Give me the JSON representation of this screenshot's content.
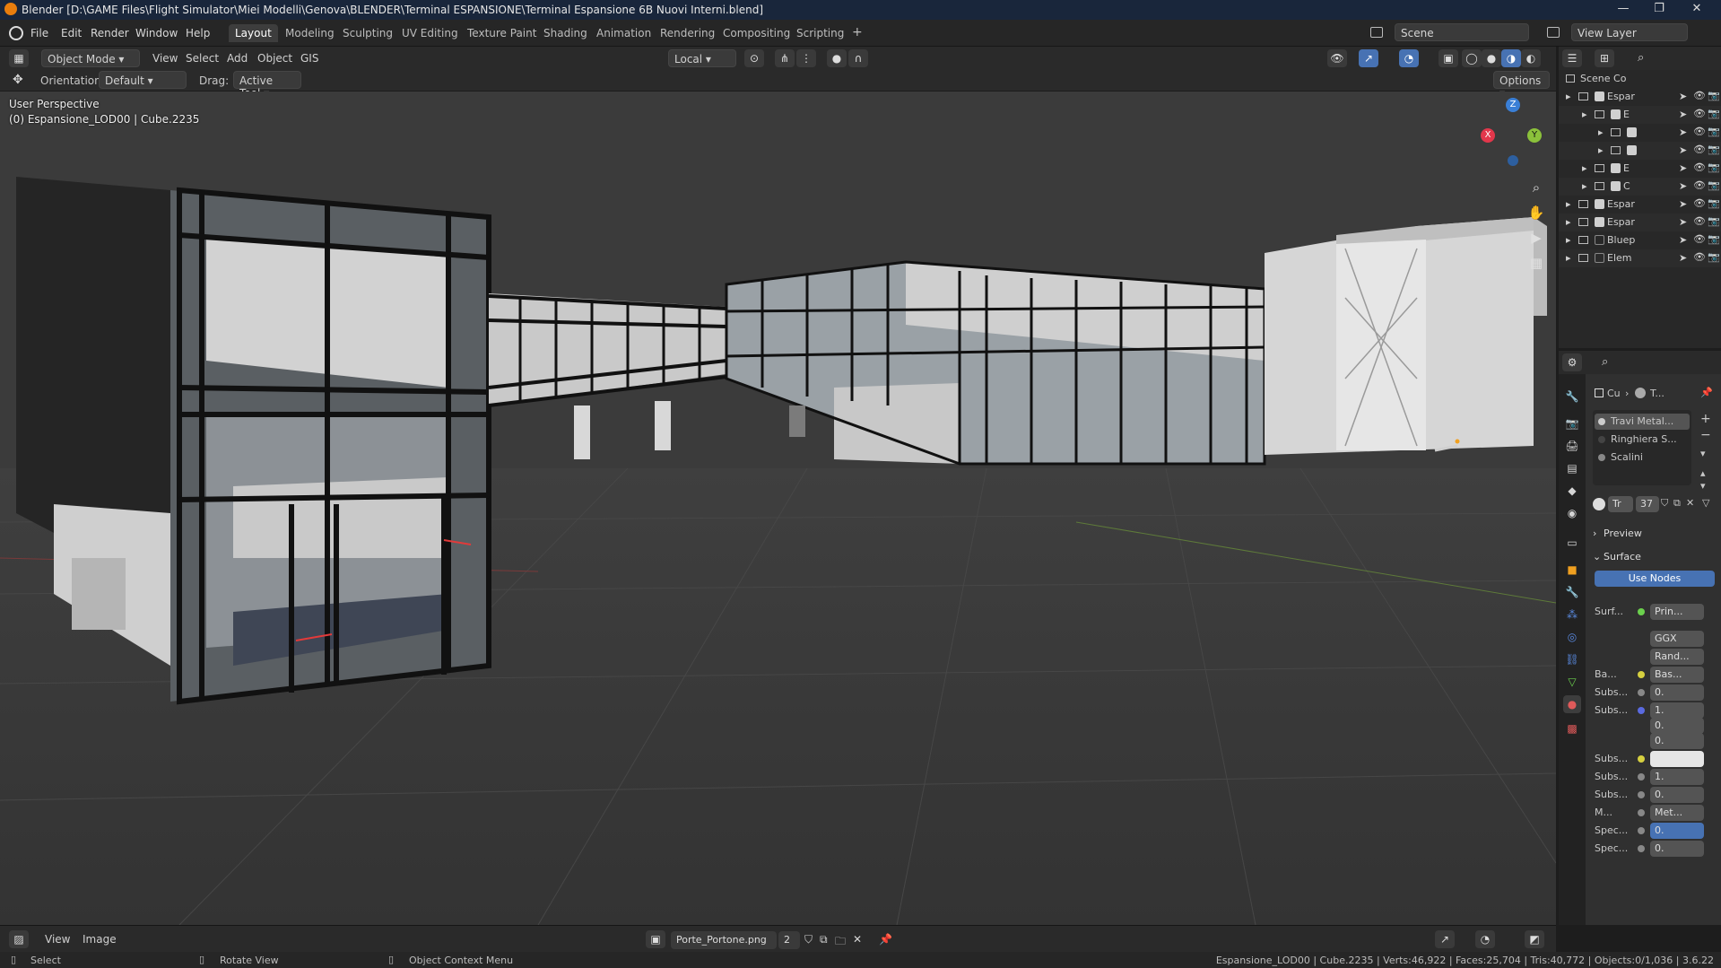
{
  "titlebar": {
    "title": "Blender [D:\\GAME Files\\Flight Simulator\\Miei Modelli\\Genova\\BLENDER\\Terminal ESPANSIONE\\Terminal Espansione 6B Nuovi Interni.blend]",
    "minimize": "—",
    "restore": "❐",
    "close": "✕"
  },
  "menu": {
    "file": "File",
    "edit": "Edit",
    "render": "Render",
    "window": "Window",
    "help": "Help"
  },
  "workspaces": [
    "Layout",
    "Modeling",
    "Sculpting",
    "UV Editing",
    "Texture Paint",
    "Shading",
    "Animation",
    "Rendering",
    "Compositing",
    "Scripting"
  ],
  "scene": {
    "name": "Scene",
    "view_layer": "View Layer"
  },
  "viewport_header": {
    "mode": "Object Mode",
    "view": "View",
    "select": "Select",
    "add": "Add",
    "object": "Object",
    "gis": "GIS",
    "transform": "Local"
  },
  "tool_settings": {
    "orientation_label": "Orientation:",
    "orientation_value": "Default",
    "drag_label": "Drag:",
    "drag_value": "Active Tool",
    "options": "Options"
  },
  "viewport": {
    "perspective": "User Perspective",
    "object_info": "(0) Espansione_LOD00 | Cube.2235",
    "axes": {
      "z": "Z",
      "y": "Y",
      "x": "X"
    }
  },
  "outliner": {
    "root": "Scene Co",
    "rows": [
      "Espar",
      "E",
      "",
      "",
      "E",
      "C",
      "Espar",
      "Espar",
      "Bluep",
      "Elem"
    ]
  },
  "properties": {
    "breadcrumb_obj": "Cu",
    "breadcrumb_mat": "T...",
    "material_slots": [
      "Travi Metal...",
      "Ringhiera S...",
      "Scalini"
    ],
    "material_name": "Tr",
    "user_count": "37",
    "preview": "Preview",
    "surface": "Surface",
    "use_nodes": "Use Nodes",
    "rows": [
      {
        "label": "Surf...",
        "value": "Prin..."
      },
      {
        "label": "",
        "value": "GGX"
      },
      {
        "label": "",
        "value": "Rand..."
      },
      {
        "label": "Ba...",
        "value": "Bas..."
      },
      {
        "label": "Subs...",
        "value": "0."
      },
      {
        "label": "Subs...",
        "value": "1."
      },
      {
        "label": "",
        "value": "0."
      },
      {
        "label": "",
        "value": "0."
      },
      {
        "label": "Subs...",
        "value": ""
      },
      {
        "label": "Subs...",
        "value": "1."
      },
      {
        "label": "Subs...",
        "value": "0."
      },
      {
        "label": "M...",
        "value": "Met..."
      },
      {
        "label": "Spec...",
        "value": "0."
      },
      {
        "label": "Spec...",
        "value": "0."
      }
    ]
  },
  "image_editor": {
    "view": "View",
    "image": "Image",
    "image_name": "Porte_Portone.png",
    "users": "2"
  },
  "statusbar": {
    "select": "Select",
    "rotate": "Rotate View",
    "context": "Object Context Menu",
    "stats": "Espansione_LOD00 | Cube.2235 | Verts:46,922 | Faces:25,704 | Tris:40,772 | Objects:0/1,036 | 3.6.22"
  },
  "colors": {
    "accent": "#4772b3",
    "axis_x": "#e2374b",
    "axis_y": "#8bc13b",
    "axis_z": "#3a7fd6"
  }
}
